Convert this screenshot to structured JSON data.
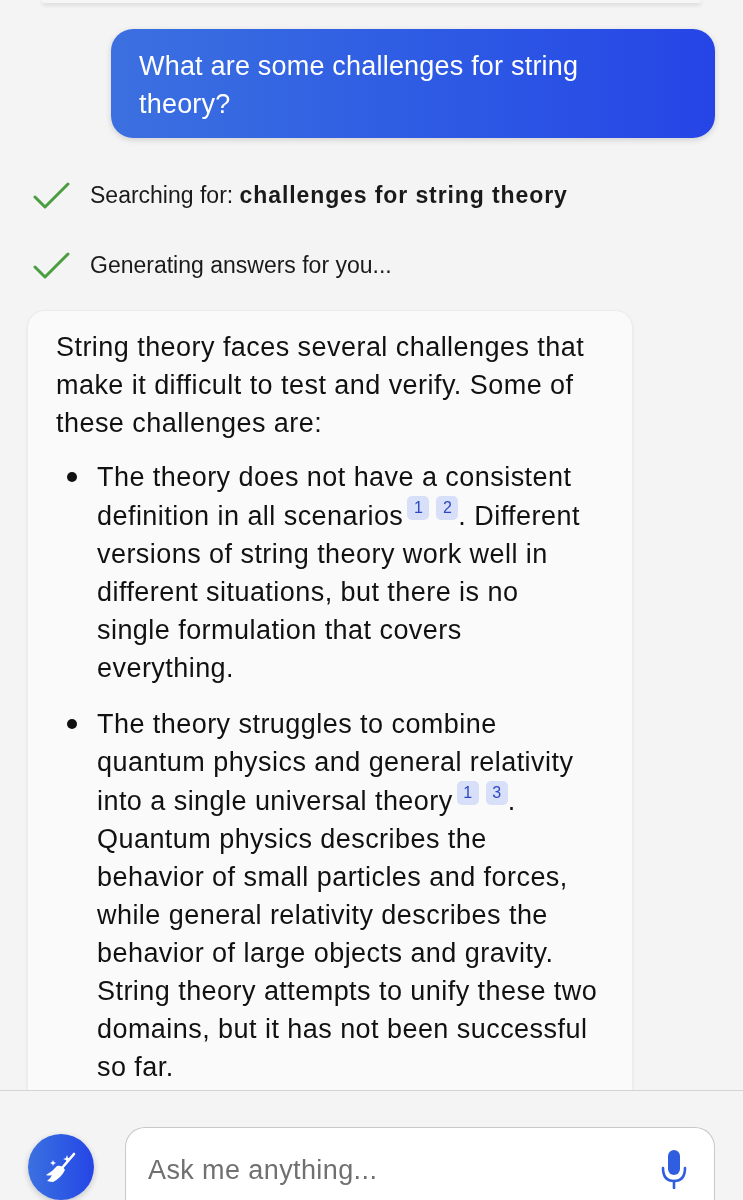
{
  "user_message": {
    "text": "What are some challenges for string theory?"
  },
  "progress_steps": [
    {
      "text": "Searching for: **challenges for string theory**",
      "done": true
    },
    {
      "text": "Generating answers for you...",
      "done": true
    }
  ],
  "answer": {
    "intro": "String theory faces several challenges that make it difficult to test and verify. Some of these challenges are:",
    "points": [
      {
        "text": "The theory does not have a consistent definition in all scenarios",
        "citations": [
          "1",
          "2"
        ],
        "continuation": ". Different versions of string theory work well in different situations, but there is no single formulation that covers everything."
      },
      {
        "text": "The theory struggles to combine quantum physics and general relativity into a single universal theory",
        "citations": [
          "1",
          "3"
        ],
        "continuation": ". Quantum physics describes the behavior of small particles and forces, while general relativity describes the behavior of large objects and gravity. String theory attempts to unify these two domains, but it has not been successful so far."
      }
    ]
  },
  "composer": {
    "placeholder": "Ask me anything..."
  }
}
